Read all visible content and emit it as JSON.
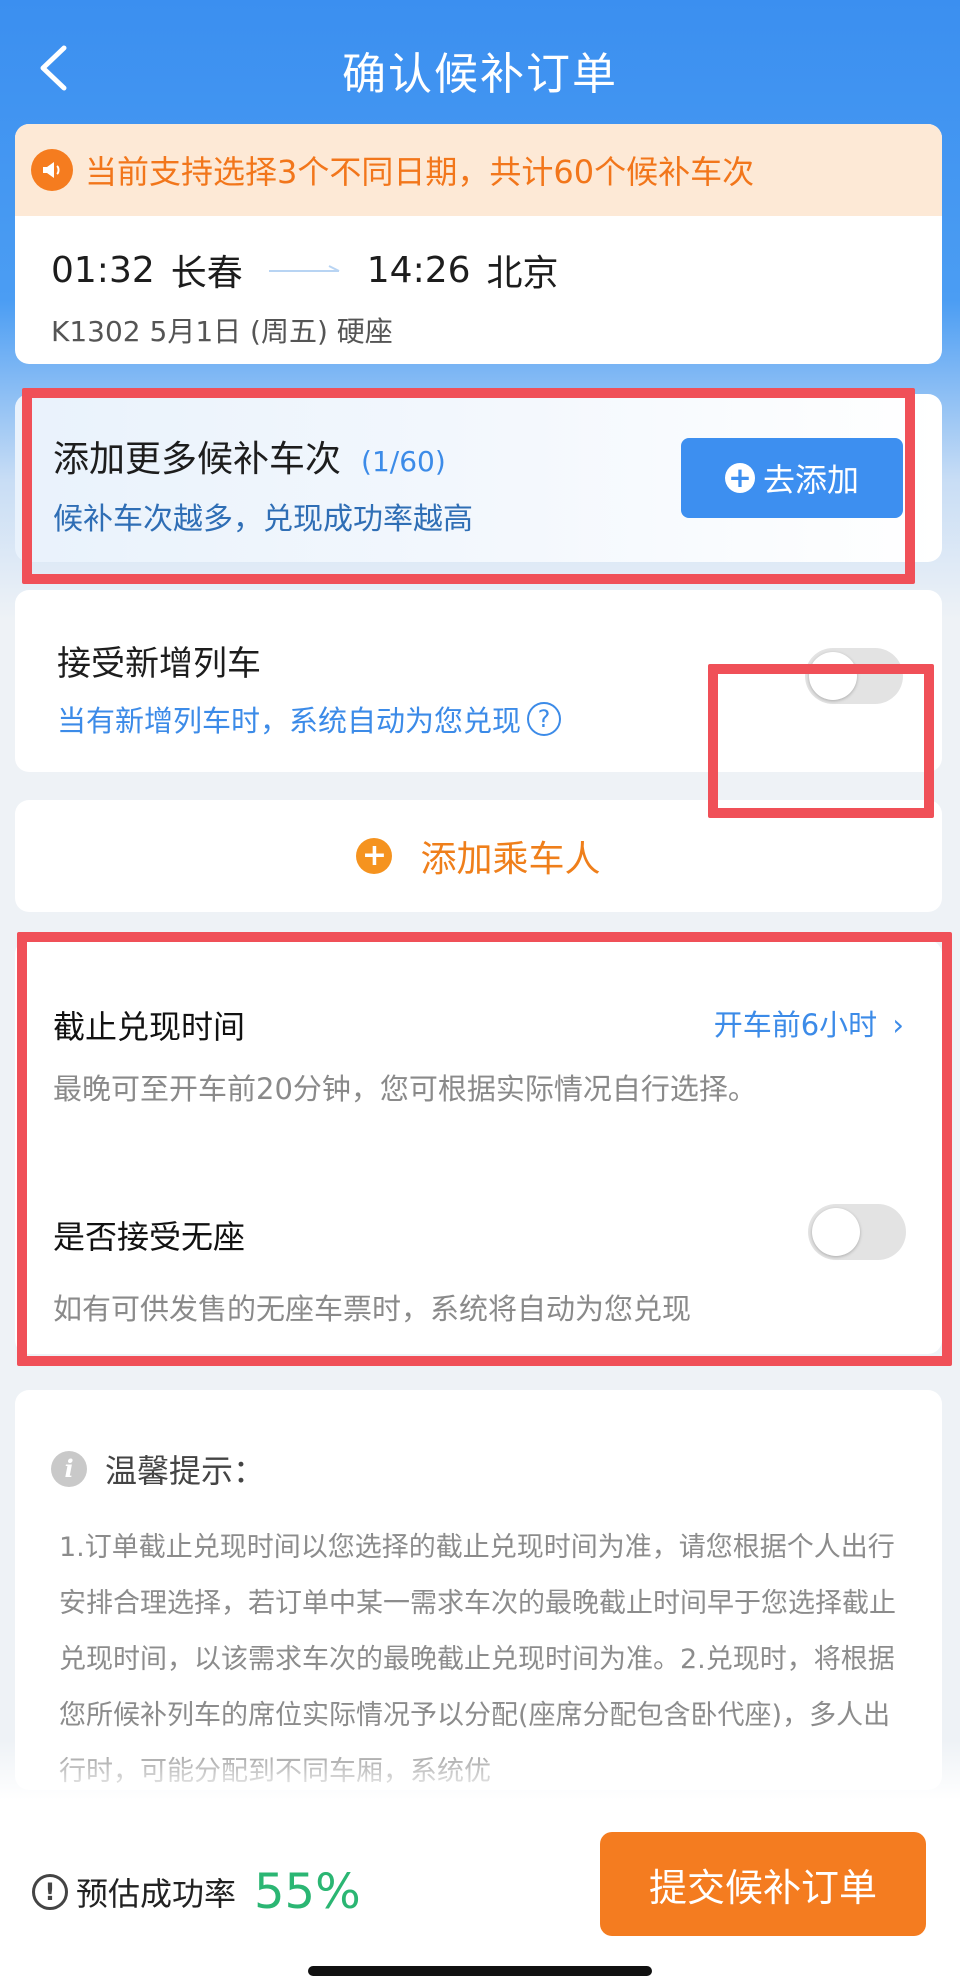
{
  "header": {
    "title": "确认候补订单"
  },
  "notice": {
    "text": "当前支持选择3个不同日期，共计60个候补车次"
  },
  "route": {
    "depart_time": "01:32",
    "depart_station": "长春",
    "arrive_time": "14:26",
    "arrive_station": "北京",
    "detail": "K1302   5月1日 (周五) 硬座"
  },
  "add_train": {
    "title": "添加更多候补车次",
    "count": "(1/60)",
    "subtitle": "候补车次越多，兑现成功率越高",
    "button_label": "去添加"
  },
  "new_train": {
    "title": "接受新增列车",
    "subtitle": "当有新增列车时，系统自动为您兑现",
    "toggle_on": false
  },
  "passenger": {
    "label": "添加乘车人"
  },
  "deadline": {
    "title": "截止兑现时间",
    "value": "开车前6小时",
    "subtitle": "最晚可至开车前20分钟，您可根据实际情况自行选择。"
  },
  "no_seat": {
    "title": "是否接受无座",
    "subtitle": "如有可供发售的无座车票时，系统将自动为您兑现",
    "toggle_on": false
  },
  "tips": {
    "title": "温馨提示：",
    "body": "1.订单截止兑现时间以您选择的截止兑现时间为准，请您根据个人出行安排合理选择，若订单中某一需求车次的最晚截止时间早于您选择截止兑现时间，以该需求车次的最晚截止兑现时间为准。2.兑现时，将根据您所候补列车的席位实际情况予以分配(座席分配包含卧代座)，多人出行时，可能分配到不同车厢，系统优"
  },
  "bottom": {
    "rate_label": "预估成功率",
    "rate_value": "55%",
    "submit_label": "提交候补订单"
  },
  "colors": {
    "primary_blue": "#3d8ff0",
    "accent_orange": "#f47c20",
    "success_green": "#2bb673",
    "annotation_red": "#f05058"
  }
}
